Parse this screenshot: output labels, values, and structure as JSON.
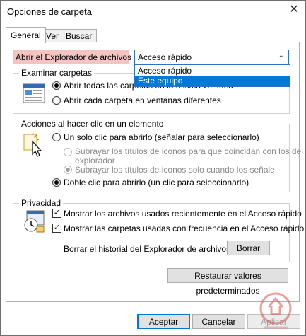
{
  "window": {
    "title": "Opciones de carpeta",
    "close_glyph": "✕"
  },
  "tabs": [
    {
      "label": "General",
      "active": true
    },
    {
      "label": "Ver",
      "active": false
    },
    {
      "label": "Buscar",
      "active": false
    }
  ],
  "explorer_open": {
    "label": "Abrir el Explorador de archivos en:",
    "selected_value": "Acceso rápido",
    "options": [
      "Acceso rápido",
      "Este equipo"
    ],
    "highlighted_option": "Este equipo"
  },
  "browse_folders": {
    "title": "Examinar carpetas",
    "options": [
      {
        "label": "Abrir todas las carpetas en la misma ventana",
        "checked": true
      },
      {
        "label": "Abrir cada carpeta en ventanas diferentes",
        "checked": false
      }
    ]
  },
  "click_actions": {
    "title": "Acciones al hacer clic en un elemento",
    "single_click": {
      "label": "Un solo clic para abrirlo (señalar para seleccionarlo)",
      "checked": false
    },
    "underline_always": {
      "label_line1": "Subrayar los títulos de iconos para que coincidan con los del",
      "label_line2": "explorador",
      "checked": false,
      "disabled": true
    },
    "underline_hover": {
      "label": "Subrayar los títulos de iconos solo cuando los señale",
      "checked": true,
      "disabled": true
    },
    "double_click": {
      "label": "Doble clic para abrirlo (un clic para seleccionarlo)",
      "checked": true
    }
  },
  "privacy": {
    "title": "Privacidad",
    "recent_files": {
      "label": "Mostrar los archivos usados recientemente en el Acceso rápido",
      "checked": true
    },
    "frequent_folders": {
      "label": "Mostrar las carpetas usadas con frecuencia en el Acceso rápido",
      "checked": true
    },
    "clear_history_label": "Borrar el historial del Explorador de archivos",
    "clear_button": "Borrar"
  },
  "restore_defaults_button": "Restaurar valores predeterminados",
  "footer": {
    "ok": "Aceptar",
    "cancel": "Cancelar",
    "apply": "Aplicar"
  },
  "colors": {
    "accent": "#0078d7",
    "label_highlight": "#f4c4c4",
    "watermark": "#d9534f"
  }
}
